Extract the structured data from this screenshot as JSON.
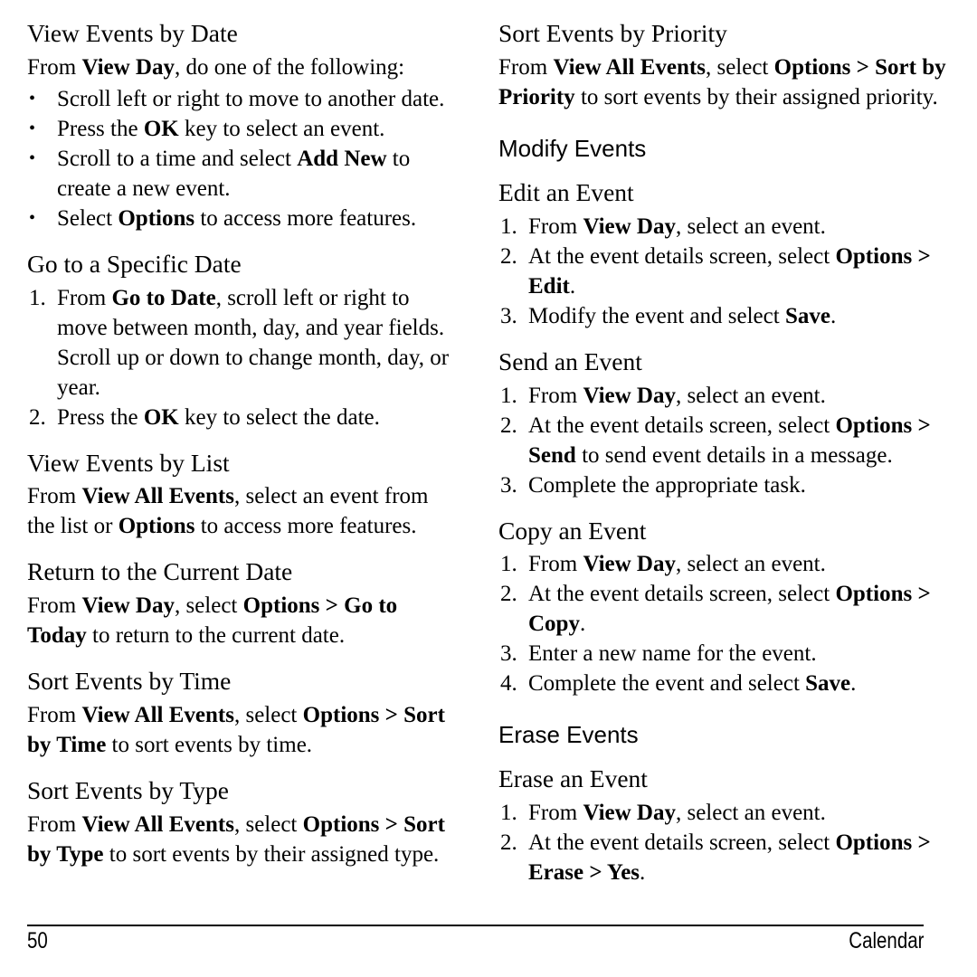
{
  "footer": {
    "page_number": "50",
    "section": "Calendar"
  },
  "left_column": [
    {
      "type": "h3",
      "title": "View Events by Date",
      "intro": [
        {
          "t": "From ",
          "b": false
        },
        {
          "t": "View Day",
          "b": true
        },
        {
          "t": ", do one of the following:",
          "b": false
        }
      ],
      "bullets": [
        [
          {
            "t": "Scroll left or right to move to another date.",
            "b": false
          }
        ],
        [
          {
            "t": "Press the ",
            "b": false
          },
          {
            "t": "OK",
            "b": true
          },
          {
            "t": " key to select an event.",
            "b": false
          }
        ],
        [
          {
            "t": "Scroll to a time and select ",
            "b": false
          },
          {
            "t": "Add New",
            "b": true
          },
          {
            "t": " to create a new event.",
            "b": false
          }
        ],
        [
          {
            "t": "Select ",
            "b": false
          },
          {
            "t": "Options",
            "b": true
          },
          {
            "t": " to access more features.",
            "b": false
          }
        ]
      ]
    },
    {
      "type": "h3",
      "title": "Go to a Specific Date",
      "steps": [
        [
          {
            "t": "From ",
            "b": false
          },
          {
            "t": "Go to Date",
            "b": true
          },
          {
            "t": ", scroll left or right to move between month, day, and year fields. Scroll up or down to change month, day, or year.",
            "b": false
          }
        ],
        [
          {
            "t": "Press the ",
            "b": false
          },
          {
            "t": "OK",
            "b": true
          },
          {
            "t": " key to select the date.",
            "b": false
          }
        ]
      ]
    },
    {
      "type": "h3",
      "title": "View Events by List",
      "paragraph": [
        {
          "t": "From ",
          "b": false
        },
        {
          "t": "View All Events",
          "b": true
        },
        {
          "t": ", select an event from the list or ",
          "b": false
        },
        {
          "t": "Options",
          "b": true
        },
        {
          "t": " to access more features.",
          "b": false
        }
      ]
    },
    {
      "type": "h3",
      "title": "Return to the Current Date",
      "paragraph": [
        {
          "t": "From ",
          "b": false
        },
        {
          "t": "View Day",
          "b": true
        },
        {
          "t": ", select ",
          "b": false
        },
        {
          "t": "Options > Go to Today",
          "b": true
        },
        {
          "t": " to return to the current date.",
          "b": false
        }
      ]
    },
    {
      "type": "h3",
      "title": "Sort Events by Time",
      "paragraph": [
        {
          "t": "From ",
          "b": false
        },
        {
          "t": "View All Events",
          "b": true
        },
        {
          "t": ", select ",
          "b": false
        },
        {
          "t": "Options > Sort by Time",
          "b": true
        },
        {
          "t": " to sort events by time.",
          "b": false
        }
      ]
    },
    {
      "type": "h3",
      "title": "Sort Events by Type",
      "paragraph": [
        {
          "t": "From ",
          "b": false
        },
        {
          "t": "View All Events",
          "b": true
        },
        {
          "t": ", select ",
          "b": false
        },
        {
          "t": "Options > Sort by Type",
          "b": true
        },
        {
          "t": " to sort events by their assigned type.",
          "b": false
        }
      ]
    }
  ],
  "right_column": [
    {
      "type": "h3",
      "title": "Sort Events by Priority",
      "paragraph": [
        {
          "t": "From ",
          "b": false
        },
        {
          "t": "View All Events",
          "b": true
        },
        {
          "t": ", select ",
          "b": false
        },
        {
          "t": "Options > Sort by Priority",
          "b": true
        },
        {
          "t": " to sort events by their assigned priority.",
          "b": false
        }
      ]
    },
    {
      "type": "h2",
      "title": "Modify Events"
    },
    {
      "type": "h3",
      "title": "Edit an Event",
      "steps": [
        [
          {
            "t": "From ",
            "b": false
          },
          {
            "t": "View Day",
            "b": true
          },
          {
            "t": ", select an event.",
            "b": false
          }
        ],
        [
          {
            "t": "At the event details screen, select ",
            "b": false
          },
          {
            "t": "Options > Edit",
            "b": true
          },
          {
            "t": ".",
            "b": false
          }
        ],
        [
          {
            "t": "Modify the event and select ",
            "b": false
          },
          {
            "t": "Save",
            "b": true
          },
          {
            "t": ".",
            "b": false
          }
        ]
      ]
    },
    {
      "type": "h3",
      "title": "Send an Event",
      "steps": [
        [
          {
            "t": "From ",
            "b": false
          },
          {
            "t": "View Day",
            "b": true
          },
          {
            "t": ", select an event.",
            "b": false
          }
        ],
        [
          {
            "t": "At the event details screen, select ",
            "b": false
          },
          {
            "t": "Options > Send",
            "b": true
          },
          {
            "t": " to send event details in a message.",
            "b": false
          }
        ],
        [
          {
            "t": "Complete the appropriate task.",
            "b": false
          }
        ]
      ]
    },
    {
      "type": "h3",
      "title": "Copy an Event",
      "steps": [
        [
          {
            "t": "From ",
            "b": false
          },
          {
            "t": "View Day",
            "b": true
          },
          {
            "t": ", select an event.",
            "b": false
          }
        ],
        [
          {
            "t": "At the event details screen, select ",
            "b": false
          },
          {
            "t": "Options > Copy",
            "b": true
          },
          {
            "t": ".",
            "b": false
          }
        ],
        [
          {
            "t": "Enter a new name for the event.",
            "b": false
          }
        ],
        [
          {
            "t": "Complete the event and select ",
            "b": false
          },
          {
            "t": "Save",
            "b": true
          },
          {
            "t": ".",
            "b": false
          }
        ]
      ]
    },
    {
      "type": "h2",
      "title": "Erase Events"
    },
    {
      "type": "h3",
      "title": "Erase an Event",
      "steps": [
        [
          {
            "t": "From ",
            "b": false
          },
          {
            "t": "View Day",
            "b": true
          },
          {
            "t": ", select an event.",
            "b": false
          }
        ],
        [
          {
            "t": "At the event details screen, select ",
            "b": false
          },
          {
            "t": "Options > Erase > Yes",
            "b": true
          },
          {
            "t": ".",
            "b": false
          }
        ]
      ]
    }
  ],
  "bullet_glyph": "•"
}
